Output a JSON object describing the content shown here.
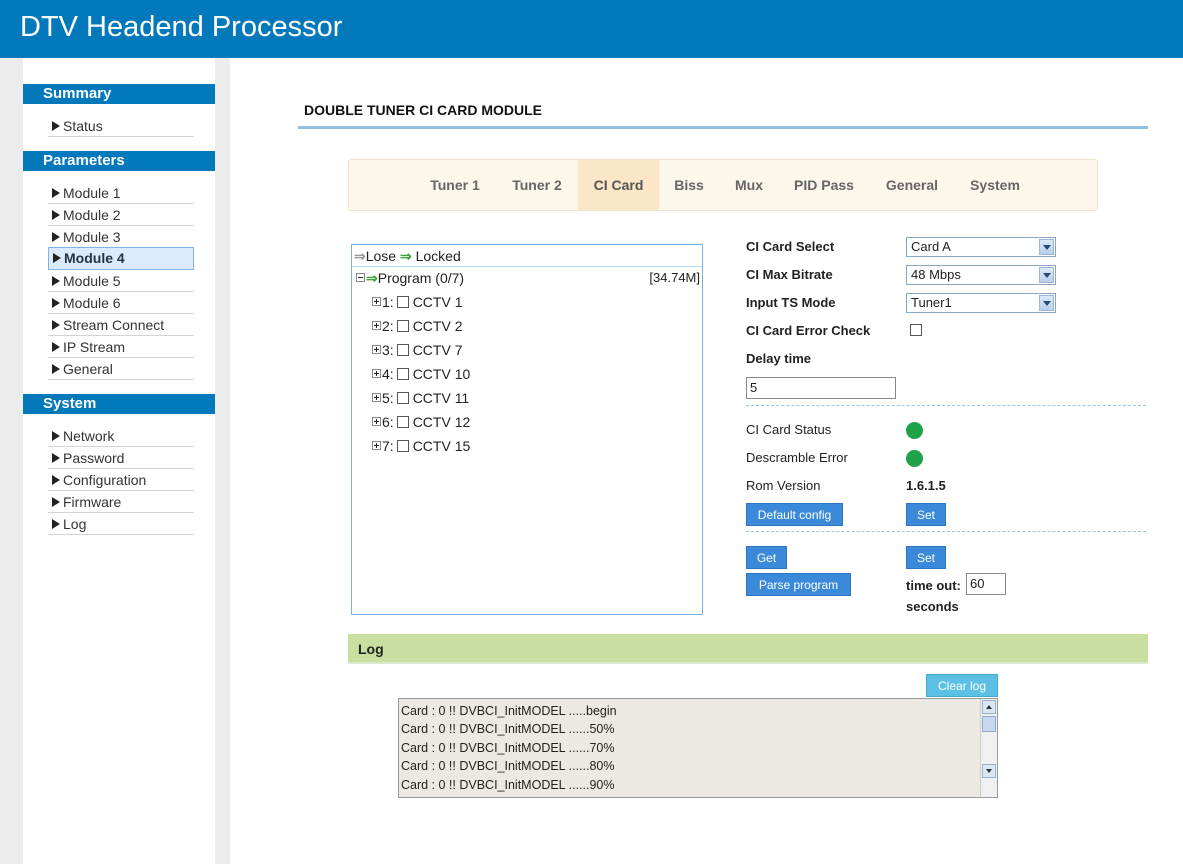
{
  "header": {
    "title": "DTV Headend Processor"
  },
  "sidebar": {
    "sections": [
      {
        "title": "Summary",
        "items": [
          "Status"
        ]
      },
      {
        "title": "Parameters",
        "items": [
          "Module 1",
          "Module 2",
          "Module 3",
          "Module 4",
          "Module 5",
          "Module 6",
          "Stream Connect",
          "IP Stream",
          "General"
        ]
      },
      {
        "title": "System",
        "items": [
          "Network",
          "Password",
          "Configuration",
          "Firmware",
          "Log"
        ]
      }
    ],
    "active_item": "Module 4"
  },
  "main": {
    "title": "DOUBLE TUNER CI CARD MODULE",
    "tabs": [
      "Tuner 1",
      "Tuner 2",
      "CI Card",
      "Biss",
      "Mux",
      "PID Pass",
      "General",
      "System"
    ],
    "active_tab": "CI Card"
  },
  "tree": {
    "legend_lose": "Lose",
    "legend_locked": "Locked",
    "root_label": "Program (0/7)",
    "root_bitrate": "[34.74M]",
    "programs": [
      {
        "index": "1:",
        "name": "CCTV 1"
      },
      {
        "index": "2:",
        "name": "CCTV 2"
      },
      {
        "index": "3:",
        "name": "CCTV 7"
      },
      {
        "index": "4:",
        "name": "CCTV 10"
      },
      {
        "index": "5:",
        "name": "CCTV 11"
      },
      {
        "index": "6:",
        "name": "CCTV 12"
      },
      {
        "index": "7:",
        "name": "CCTV 15"
      }
    ]
  },
  "settings": {
    "ci_card_select_label": "CI Card Select",
    "ci_card_select_value": "Card A",
    "ci_max_bitrate_label": "CI Max Bitrate",
    "ci_max_bitrate_value": "48 Mbps",
    "input_ts_mode_label": "Input TS Mode",
    "input_ts_mode_value": "Tuner1",
    "error_check_label": "CI Card Error Check",
    "error_check_checked": false,
    "delay_time_label": "Delay time",
    "delay_time_value": "5",
    "ci_card_status_label": "CI Card Status",
    "descramble_error_label": "Descramble Error",
    "rom_version_label": "Rom Version",
    "rom_version_value": "1.6.1.5",
    "status_color": "#1ea34a",
    "default_config_button": "Default config",
    "set_button": "Set",
    "get_button": "Get",
    "set_button_2": "Set",
    "parse_program_button": "Parse program",
    "timeout_label": "time out:",
    "timeout_value": "60",
    "seconds_label": "seconds"
  },
  "log": {
    "title": "Log",
    "clear_button": "Clear log",
    "lines": [
      "Card : 0 !! DVBCI_InitMODEL .....begin",
      "Card : 0 !! DVBCI_InitMODEL ......50%",
      "Card : 0 !! DVBCI_InitMODEL ......70%",
      "Card : 0 !! DVBCI_InitMODEL ......80%",
      "Card : 0 !! DVBCI_InitMODEL ......90%"
    ]
  }
}
